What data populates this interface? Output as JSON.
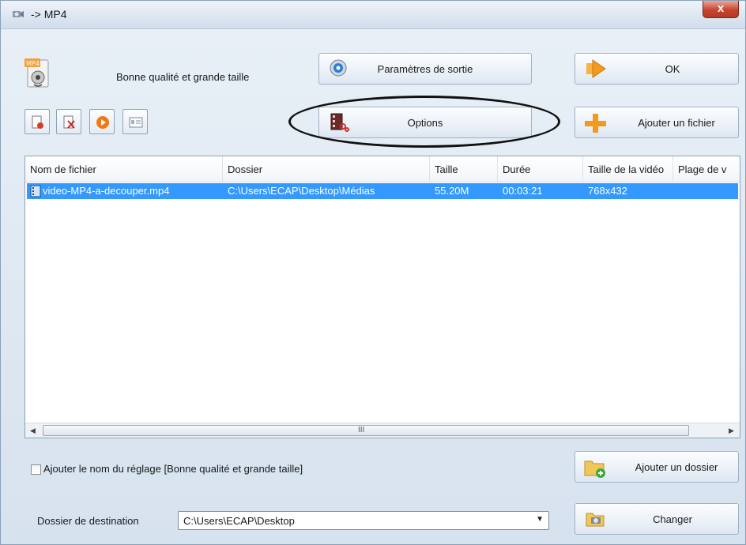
{
  "window": {
    "title": "-> MP4",
    "close_label": "x"
  },
  "preset": {
    "label": "Bonne qualité et grande taille"
  },
  "buttons": {
    "output_settings": "Paramètres de sortie",
    "ok": "OK",
    "options": "Options",
    "add_file": "Ajouter un fichier",
    "add_folder": "Ajouter un dossier",
    "change": "Changer"
  },
  "toolbar": {
    "items": [
      "remove-file-icon",
      "clear-list-icon",
      "play-icon",
      "info-icon"
    ]
  },
  "file_list": {
    "columns": [
      "Nom de fichier",
      "Dossier",
      "Taille",
      "Durée",
      "Taille de la vidéo",
      "Plage de v"
    ],
    "rows": [
      {
        "name": "video-MP4-a-decouper.mp4",
        "folder": "C:\\Users\\ECAP\\Desktop\\Médias",
        "size": "55.20M",
        "duration": "00:03:21",
        "video_size": "768x432",
        "range": ""
      }
    ],
    "scroll_grip": "III"
  },
  "append_preset": {
    "label": "Ajouter le nom du réglage [Bonne qualité et grande taille]",
    "checked": false
  },
  "destination": {
    "label": "Dossier de destination",
    "value": "C:\\Users\\ECAP\\Desktop"
  },
  "colors": {
    "selection": "#3399ff",
    "close": "#c8452f",
    "accent_orange": "#f39a1c"
  }
}
